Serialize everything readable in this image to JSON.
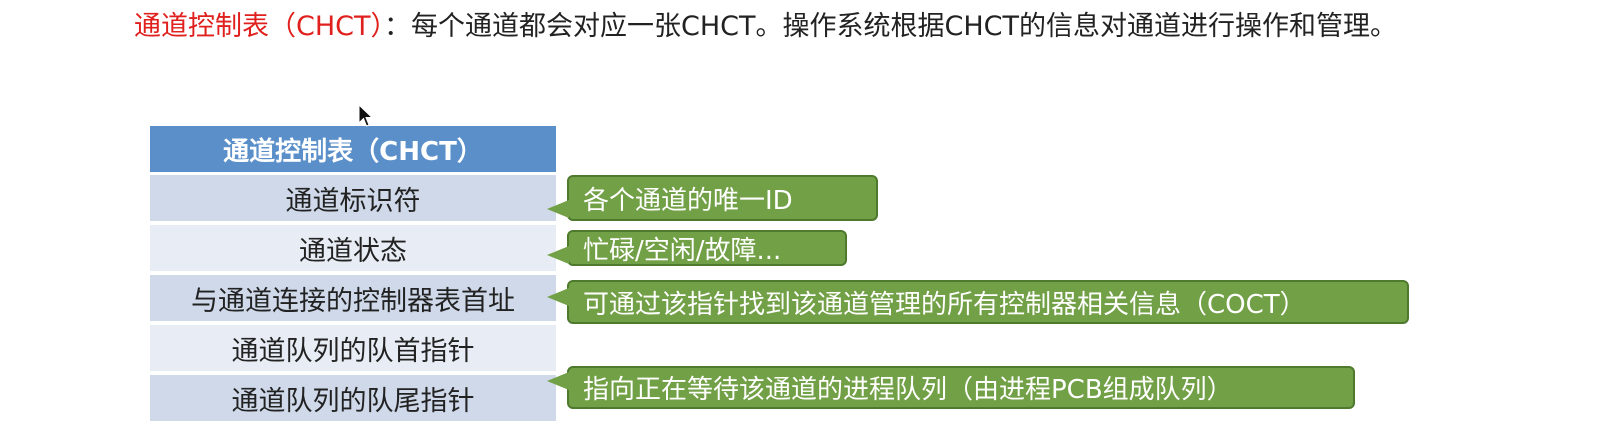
{
  "intro": {
    "term": "通道控制表（CHCT）",
    "text": "：每个通道都会对应一张CHCT。操作系统根据CHCT的信息对通道进行操作和管理。"
  },
  "table": {
    "header": "通道控制表（CHCT）",
    "rows": [
      "通道标识符",
      "通道状态",
      "与通道连接的控制器表首址",
      "通道队列的队首指针",
      "通道队列的队尾指针"
    ]
  },
  "callouts": [
    "各个通道的唯一ID",
    "忙碌/空闲/故障...",
    "可通过该指针找到该通道管理的所有控制器相关信息（COCT）",
    "指向正在等待该通道的进程队列（由进程PCB组成队列）"
  ],
  "colors": {
    "term": "#e0201c",
    "header_bg": "#5b8fc9",
    "row_dark": "#cfd9ea",
    "row_light": "#e8edf5",
    "callout_bg": "#72a046"
  }
}
